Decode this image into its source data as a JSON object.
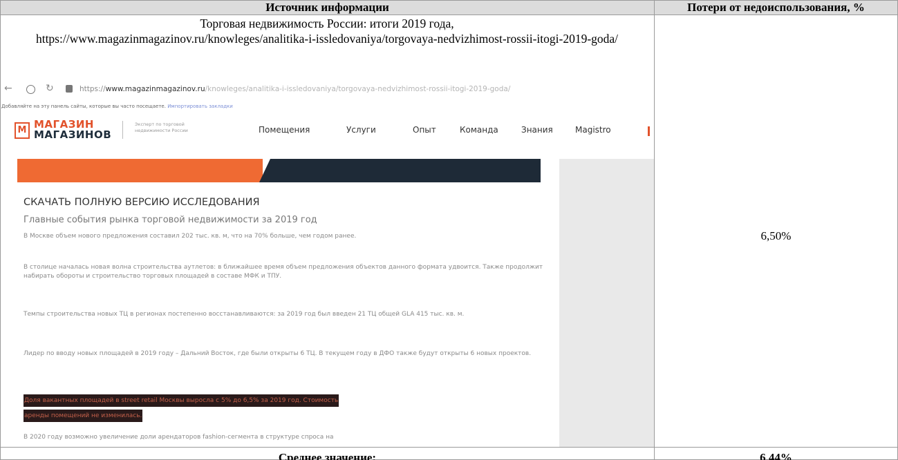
{
  "table": {
    "header_source": "Источник информации",
    "header_loss": "Потери от недоиспользования, %",
    "source_title": "Торговая недвижимость России: итоги 2019 года,",
    "source_url": "https://www.magazinmagazinov.ru/knowleges/analitika-i-issledovaniya/torgovaya-nedvizhimost-rossii-itogi-2019-goda/",
    "loss_value": "6,50%",
    "footer_label": "Среднее значение:",
    "footer_value": "6,44%"
  },
  "screenshot": {
    "address_prefix": "https://",
    "address_domain": "www.magazinmagazinov.ru",
    "address_path": "/knowleges/analitika-i-issledovaniya/torgovaya-nedvizhimost-rossii-itogi-2019-goda/",
    "bookmarks_text": "Добавляйте на эту панель сайты, которые вы часто посещаете.",
    "bookmarks_link": "Импортировать закладки",
    "logo_letter": "М",
    "logo_line1": "МАГАЗИН",
    "logo_line2": "МАГАЗИНОВ",
    "tagline": "Эксперт по торговой недвижимости России",
    "menu": [
      "Помещения",
      "Услуги",
      "Опыт",
      "Команда",
      "Знания",
      "Magistro"
    ],
    "heading": "СКАЧАТЬ ПОЛНУЮ ВЕРСИЮ ИССЛЕДОВАНИЯ",
    "subheading": "Главные события рынка торговой недвижимости за 2019 год",
    "paragraphs": [
      "В Москве объем нового предложения составил 202 тыс. кв. м, что на 70% больше, чем годом ранее.",
      "В столице началась новая волна строительства аутлетов: в ближайшее время объем предложения объектов данного формата удвоится. Также продолжит набирать обороты и строительство торговых площадей в составе МФК и ТПУ.",
      "Темпы строительства новых ТЦ в регионах постепенно восстанавливаются: за 2019 год был введен 21 ТЦ общей GLA 415 тыс. кв. м.",
      "Лидер по вводу новых площадей в 2019 году – Дальний Восток, где были открыты 6 ТЦ. В текущем году в ДФО также будут открыты 6 новых проектов."
    ],
    "highlight_line1": "Доля вакантных площадей в street retail Москвы выросла с 5% до 6,5% за 2019 год. Стоимость",
    "highlight_line2": "аренды помещений не изменилась.",
    "last_paragraph": "В 2020 году возможно увеличение доли арендаторов fashion-сегмента в структуре спроса на"
  }
}
